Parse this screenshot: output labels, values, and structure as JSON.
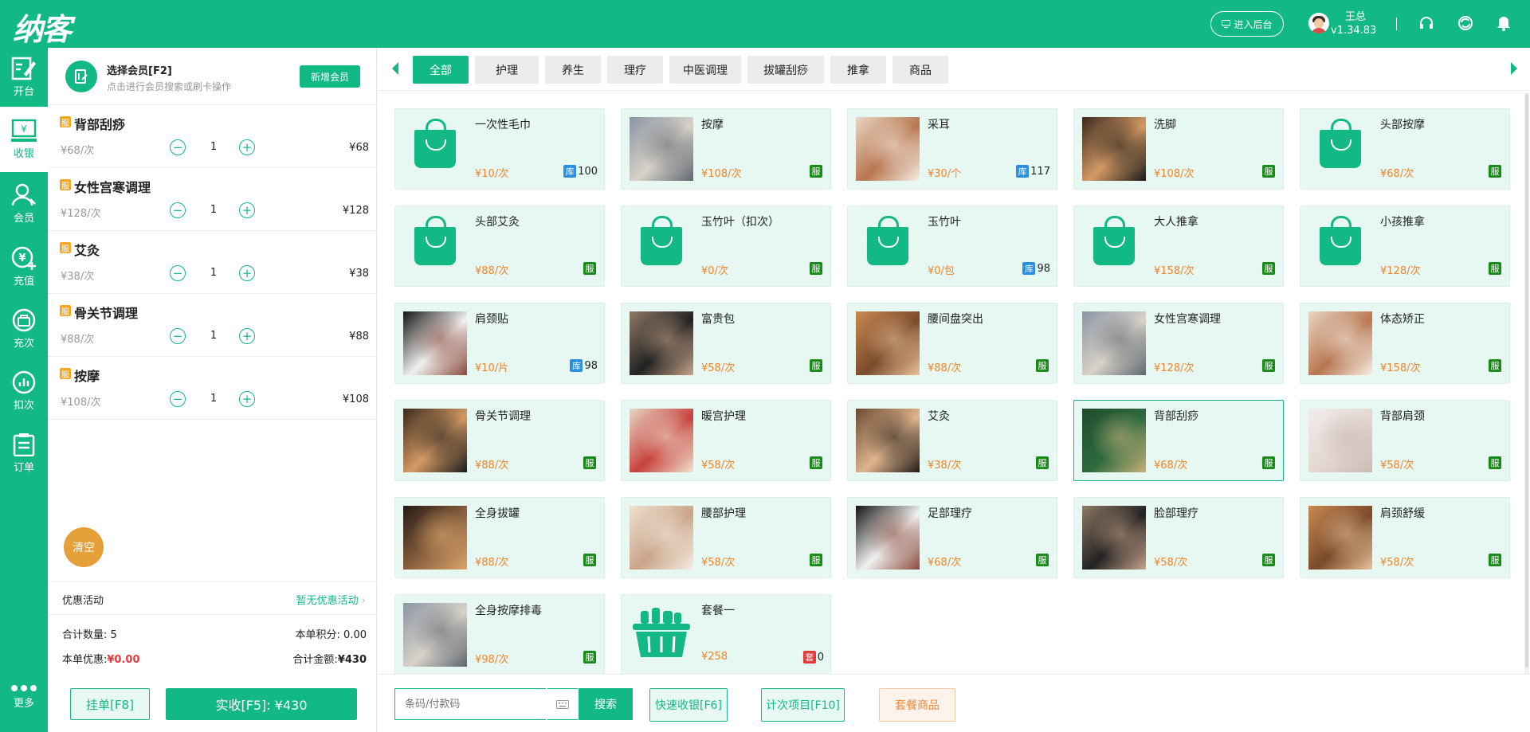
{
  "app": {
    "logo": "纳客",
    "admin_button": "进入后台",
    "user_name": "王总",
    "version": "v1.34.83"
  },
  "colors": {
    "primary": "#13b985",
    "orange": "#f0842e",
    "red": "#e5383b",
    "tag_service": "#1a8a1a",
    "tag_stock": "#2a8fe0"
  },
  "sidebar": {
    "items": [
      {
        "label": "开台",
        "icon": "edit-icon"
      },
      {
        "label": "收银",
        "icon": "cashier-icon"
      },
      {
        "label": "会员",
        "icon": "member-icon"
      },
      {
        "label": "充值",
        "icon": "recharge-icon"
      },
      {
        "label": "充次",
        "icon": "bag-icon"
      },
      {
        "label": "扣次",
        "icon": "chart-icon"
      },
      {
        "label": "订单",
        "icon": "order-icon"
      }
    ],
    "more": "更多"
  },
  "member": {
    "title": "选择会员[F2]",
    "subtitle": "点击进行会员搜索或刷卡操作",
    "add_button": "新增会员"
  },
  "cart": {
    "badge": "服",
    "items": [
      {
        "name": "背部刮痧",
        "unit_price": "¥68/次",
        "qty": "1",
        "total": "¥68"
      },
      {
        "name": "女性宫寒调理",
        "unit_price": "¥128/次",
        "qty": "1",
        "total": "¥128"
      },
      {
        "name": "艾灸",
        "unit_price": "¥38/次",
        "qty": "1",
        "total": "¥38"
      },
      {
        "name": "骨关节调理",
        "unit_price": "¥88/次",
        "qty": "1",
        "total": "¥88"
      },
      {
        "name": "按摩",
        "unit_price": "¥108/次",
        "qty": "1",
        "total": "¥108"
      }
    ],
    "clear": "清空"
  },
  "promo": {
    "label": "优惠活动",
    "value": "暂无优惠活动"
  },
  "summary": {
    "count_label": "合计数量:",
    "count": "5",
    "points_label": "本单积分:",
    "points": "0.00",
    "discount_label": "本单优惠:",
    "discount": "¥0.00",
    "amount_label": "合计金额:",
    "amount": "¥430"
  },
  "actions": {
    "hold": "挂单[F8]",
    "pay": "实收[F5]: ¥430"
  },
  "tabs": [
    "全部",
    "护理",
    "养生",
    "理疗",
    "中医调理",
    "拔罐刮痧",
    "推拿",
    "商品"
  ],
  "products": [
    {
      "name": "一次性毛巾",
      "price": "¥10/次",
      "tag": "库",
      "stock": "100",
      "thumb": "bag"
    },
    {
      "name": "按摩",
      "price": "¥108/次",
      "tag": "服",
      "stock": "",
      "thumb": "photo"
    },
    {
      "name": "采耳",
      "price": "¥30/个",
      "tag": "库",
      "stock": "117",
      "thumb": "photo"
    },
    {
      "name": "洗脚",
      "price": "¥108/次",
      "tag": "服",
      "stock": "",
      "thumb": "photo"
    },
    {
      "name": "头部按摩",
      "price": "¥68/次",
      "tag": "服",
      "stock": "",
      "thumb": "bag"
    },
    {
      "name": "头部艾灸",
      "price": "¥88/次",
      "tag": "服",
      "stock": "",
      "thumb": "bag"
    },
    {
      "name": "玉竹叶（扣次）",
      "price": "¥0/次",
      "tag": "服",
      "stock": "",
      "thumb": "bag"
    },
    {
      "name": "玉竹叶",
      "price": "¥0/包",
      "tag": "库",
      "stock": "98",
      "thumb": "bag"
    },
    {
      "name": "大人推拿",
      "price": "¥158/次",
      "tag": "服",
      "stock": "",
      "thumb": "bag"
    },
    {
      "name": "小孩推拿",
      "price": "¥128/次",
      "tag": "服",
      "stock": "",
      "thumb": "bag"
    },
    {
      "name": "肩颈贴",
      "price": "¥10/片",
      "tag": "库",
      "stock": "98",
      "thumb": "photo"
    },
    {
      "name": "富贵包",
      "price": "¥58/次",
      "tag": "服",
      "stock": "",
      "thumb": "photo"
    },
    {
      "name": "腰间盘突出",
      "price": "¥88/次",
      "tag": "服",
      "stock": "",
      "thumb": "photo"
    },
    {
      "name": "女性宫寒调理",
      "price": "¥128/次",
      "tag": "服",
      "stock": "",
      "thumb": "photo"
    },
    {
      "name": "体态矫正",
      "price": "¥158/次",
      "tag": "服",
      "stock": "",
      "thumb": "photo"
    },
    {
      "name": "骨关节调理",
      "price": "¥88/次",
      "tag": "服",
      "stock": "",
      "thumb": "photo"
    },
    {
      "name": "暖宫护理",
      "price": "¥58/次",
      "tag": "服",
      "stock": "",
      "thumb": "photo"
    },
    {
      "name": "艾灸",
      "price": "¥38/次",
      "tag": "服",
      "stock": "",
      "thumb": "photo"
    },
    {
      "name": "背部刮痧",
      "price": "¥68/次",
      "tag": "服",
      "stock": "",
      "thumb": "photo",
      "selected": true
    },
    {
      "name": "背部肩颈",
      "price": "¥58/次",
      "tag": "服",
      "stock": "",
      "thumb": "photo"
    },
    {
      "name": "全身拔罐",
      "price": "¥88/次",
      "tag": "服",
      "stock": "",
      "thumb": "photo"
    },
    {
      "name": "腰部护理",
      "price": "¥58/次",
      "tag": "服",
      "stock": "",
      "thumb": "photo"
    },
    {
      "name": "足部理疗",
      "price": "¥68/次",
      "tag": "服",
      "stock": "",
      "thumb": "photo"
    },
    {
      "name": "脸部理疗",
      "price": "¥58/次",
      "tag": "服",
      "stock": "",
      "thumb": "photo"
    },
    {
      "name": "肩颈舒缓",
      "price": "¥58/次",
      "tag": "服",
      "stock": "",
      "thumb": "photo"
    },
    {
      "name": "全身按摩排毒",
      "price": "¥98/次",
      "tag": "服",
      "stock": "",
      "thumb": "photo"
    },
    {
      "name": "套餐一",
      "price": "¥258",
      "tag": "套",
      "stock": "0",
      "thumb": "basket"
    }
  ],
  "bottom": {
    "search_placeholder": "条码/付款码",
    "search_button": "搜索",
    "quick_pay": "快速收银[F6]",
    "count_items": "计次项目[F10]",
    "package": "套餐商品"
  }
}
